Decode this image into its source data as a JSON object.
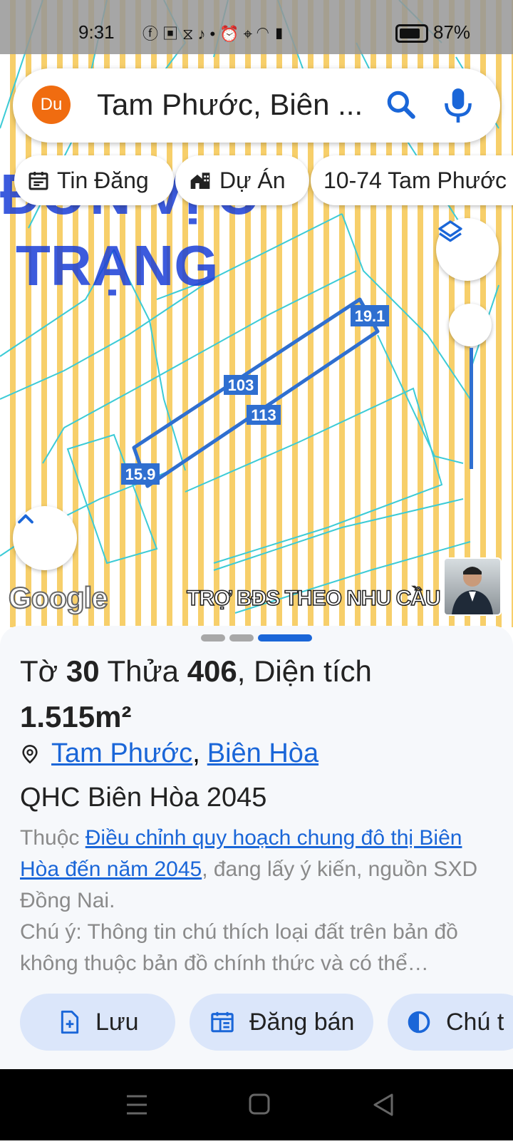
{
  "status_bar": {
    "time": "9:31",
    "battery_percent": "87%"
  },
  "search": {
    "avatar": "Du",
    "query": "Tam Phước, Biên ..."
  },
  "chips": [
    {
      "label": "Tin Đăng",
      "icon": "calendar-icon"
    },
    {
      "label": "Dự Án",
      "icon": "building-icon"
    },
    {
      "label": "10-74 Tam Phước"
    }
  ],
  "map": {
    "background_text_1": "ĐƠN VỊ C",
    "background_text_2": "TRẠNG",
    "edge_labels": [
      "19.1",
      "103",
      "113",
      "15.9"
    ],
    "logo": "Google",
    "overlay_text": "TRỢ BĐS THEO NHU CẦU",
    "zoom_level": 0.0
  },
  "parcel": {
    "title_prefix": "Tờ",
    "sheet_no": "30",
    "title_mid": "Thửa",
    "parcel_no": "406",
    "title_suffix": ", Diện tích",
    "area": "1.515m²",
    "location_ward": "Tam Phước",
    "location_sep": ",",
    "location_city": "Biên Hòa",
    "plan_title": "QHC Biên Hòa 2045",
    "desc_prefix": "Thuộc",
    "desc_link": "Điều chỉnh quy hoạch chung đô thị Biên Hòa đến năm 2045",
    "desc_suffix": ", đang lấy ý kiến, nguồn SXD Đồng Nai.",
    "note": "Chú ý: Thông tin chú thích loại đất trên bản đồ không thuộc bản đồ chính thức và có thể…"
  },
  "actions": [
    {
      "label": "Lưu",
      "icon": "add-file-icon"
    },
    {
      "label": "Đăng bán",
      "icon": "listing-icon"
    },
    {
      "label": "Chú t",
      "icon": "legend-icon"
    }
  ],
  "colors": {
    "accent": "#1a66d8",
    "avatar": "#f06c10",
    "stripe": "#f7cf6a",
    "parcel_line": "#2f6fd0",
    "cadastral_line": "#3ccbd6"
  }
}
